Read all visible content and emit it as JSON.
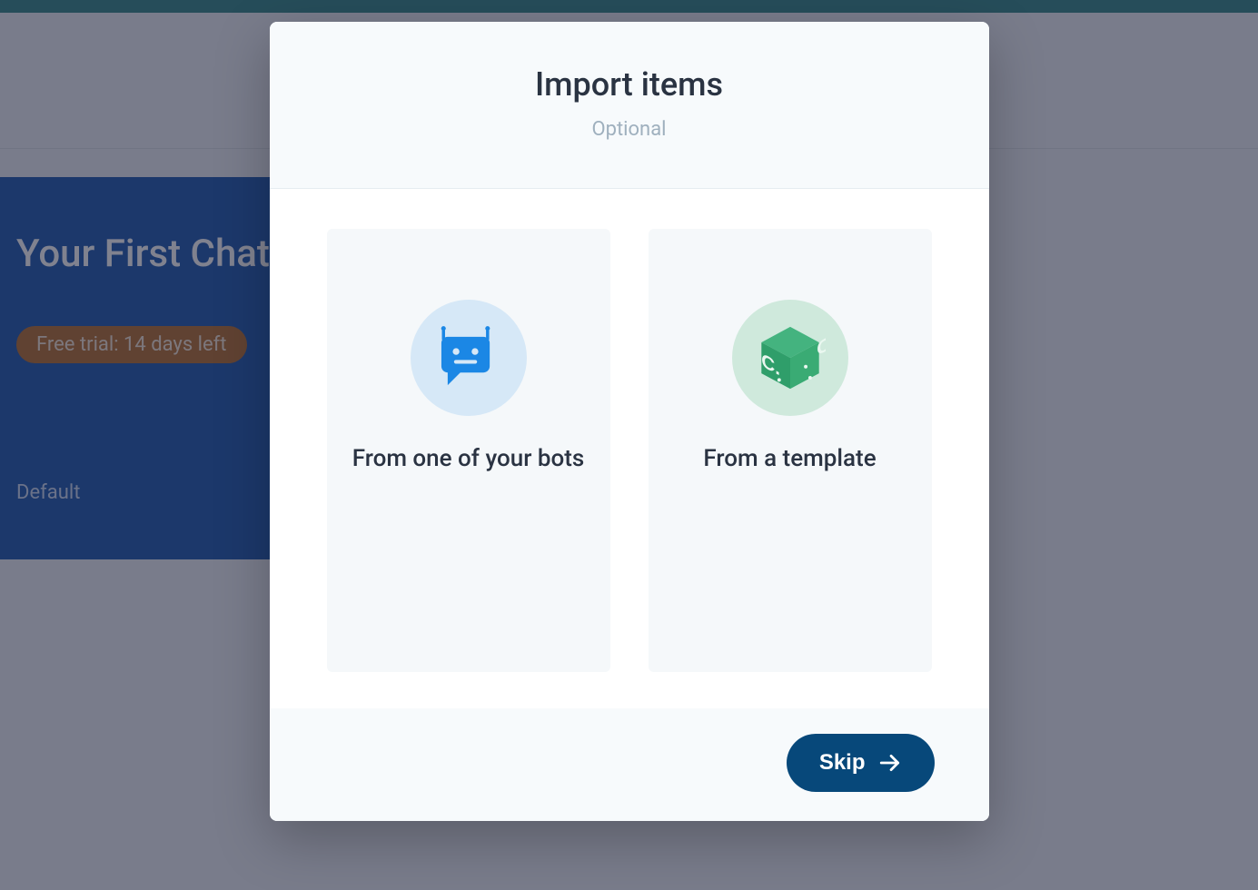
{
  "background": {
    "card_title": "Your First Chatbot",
    "trial_badge": "Free trial: 14 days left",
    "default_label": "Default"
  },
  "modal": {
    "title": "Import items",
    "subtitle": "Optional",
    "options": {
      "from_bot": {
        "label": "From one of your bots"
      },
      "from_template": {
        "label": "From a template"
      }
    },
    "skip_label": "Skip"
  }
}
